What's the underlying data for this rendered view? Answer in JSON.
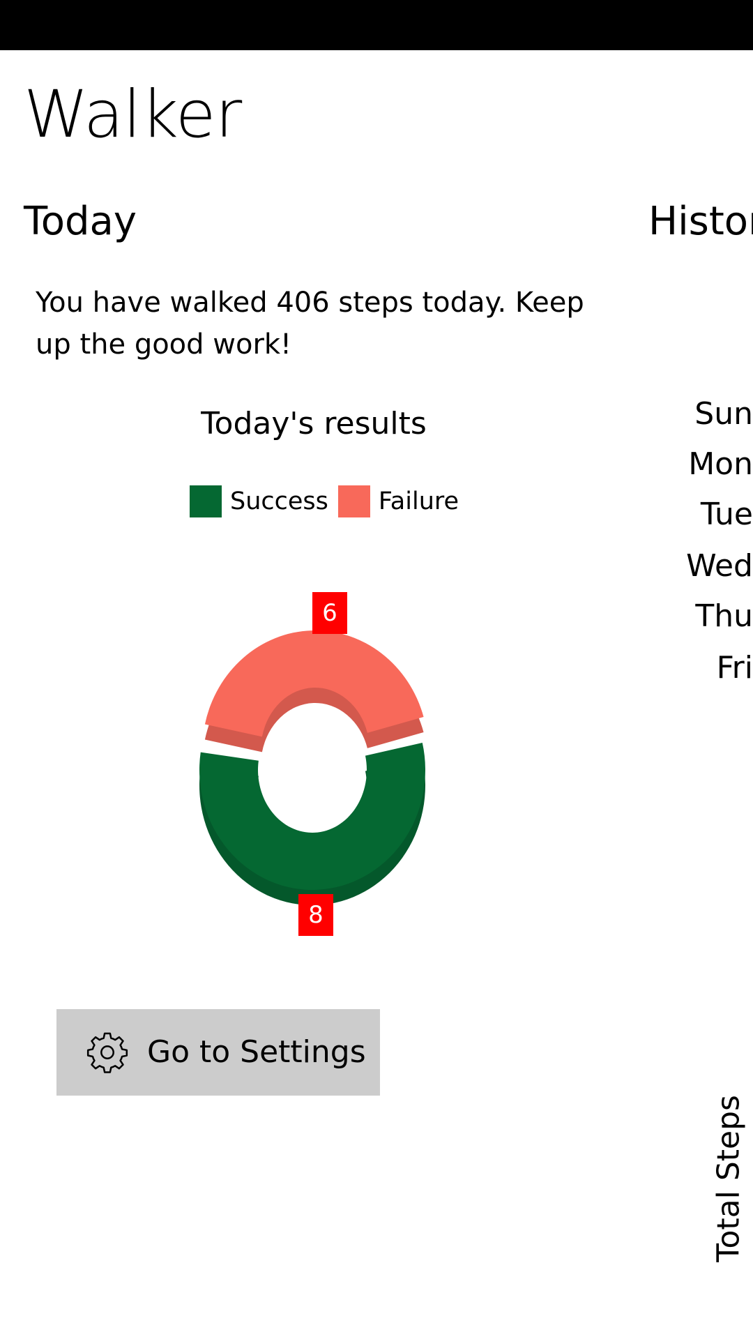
{
  "app": {
    "title": "Walker"
  },
  "today": {
    "title": "Today",
    "summary": "You have walked 406 steps today. Keep up the good work!"
  },
  "history": {
    "title": "History",
    "days": [
      "Sun",
      "Mon",
      "Tue",
      "Wed",
      "Thu",
      "Fri"
    ],
    "axis_title": "Total Steps"
  },
  "settings_button": {
    "label": "Go to Settings",
    "icon": "gear-icon"
  },
  "chart_data": {
    "type": "pie",
    "style": "3d-doughnut",
    "title": "Today's results",
    "legend_position": "top",
    "categories": [
      "Success",
      "Failure"
    ],
    "values": [
      8,
      6
    ],
    "data_labels": [
      "8",
      "6"
    ],
    "colors": [
      "#056832",
      "#f8695a"
    ],
    "label_color": "#ff0000"
  }
}
